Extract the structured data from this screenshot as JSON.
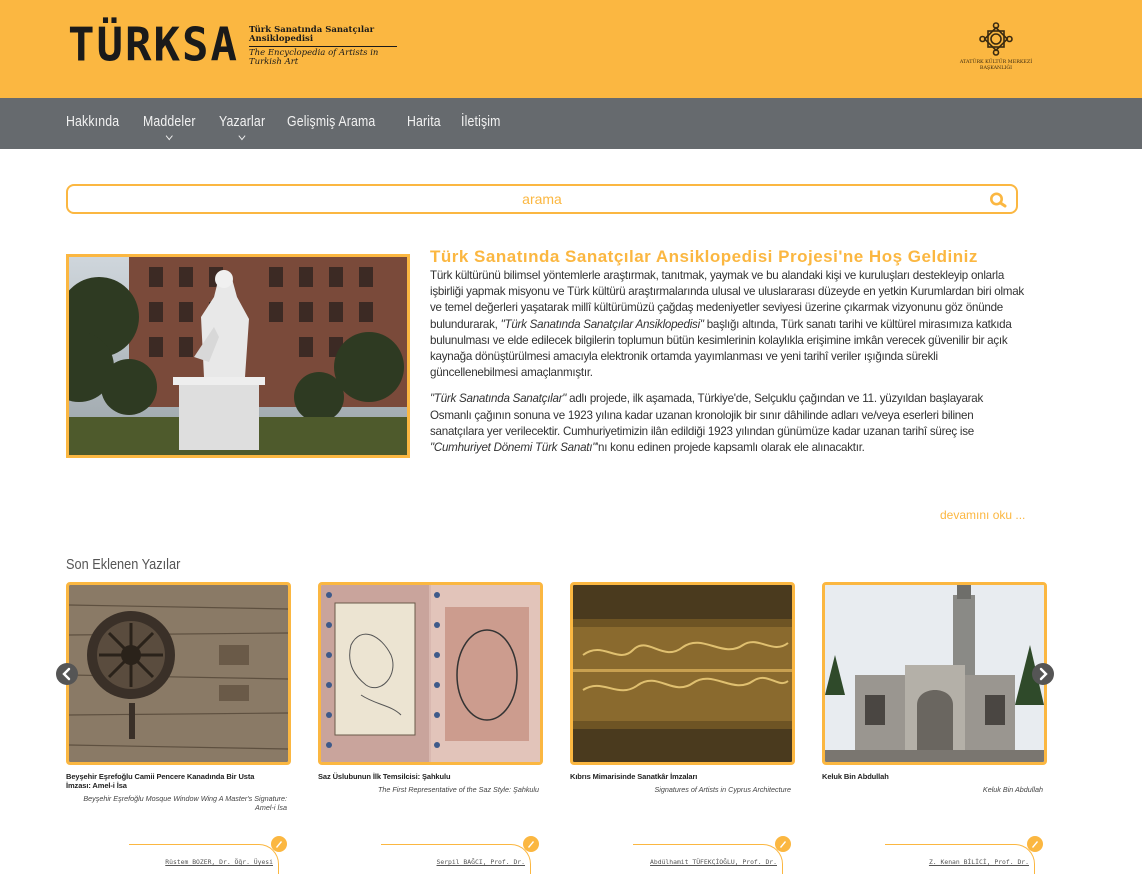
{
  "header": {
    "logo_word": "TÜRKSA",
    "logo_tr": "Türk Sanatında Sanatçılar Ansiklopedisi",
    "logo_en": "The Encyclopedia of Artists in Turkish Art",
    "org_line1": "ATATÜRK KÜLTÜR MERKEZİ",
    "org_line2": "BAŞKANLIĞI"
  },
  "nav": {
    "items": [
      {
        "label": "Hakkında"
      },
      {
        "label": "Maddeler"
      },
      {
        "label": "Yazarlar"
      },
      {
        "label": "Gelişmiş Arama"
      },
      {
        "label": "Harita"
      },
      {
        "label": "İletişim"
      }
    ]
  },
  "search": {
    "placeholder": "arama"
  },
  "welcome": {
    "title": "Türk Sanatında Sanatçılar Ansiklopedisi Projesi'ne Hoş Geldiniz",
    "p1_a": "Türk kültürünü bilimsel yöntemlerle araştırmak, tanıtmak, yaymak ve bu alandaki kişi ve kuruluşları destekleyip onlarla işbirliği yapmak misyonu ve Türk kültürü araştırmalarında ulusal ve uluslararası düzeyde en yetkin Kurumlardan biri olmak ve temel değerleri yaşatarak millî kültürümüzü çağdaş medeniyetler seviyesi üzerine çıkarmak vizyonunu göz önünde bulundurarak, ",
    "p1_em": "\"Türk Sanatında Sanatçılar Ansiklopedisi\"",
    "p1_b": " başlığı altında, Türk sanatı tarihi ve kültürel mirasımıza katkıda bulunulması ve elde edilecek bilgilerin toplumun bütün kesimlerinin kolaylıkla erişimine imkân verecek güvenilir bir açık kaynağa dönüştürülmesi amacıyla elektronik ortamda yayımlanması ve yeni tarihî veriler ışığında sürekli güncellenebilmesi amaçlanmıştır.",
    "p2_em": "\"Türk Sanatında Sanatçılar\"",
    "p2_a": " adlı projede, ilk aşamada, Türkiye'de, Selçuklu çağından ve 11. yüzyıldan başlayarak Osmanlı çağının sonuna ve 1923 yılına kadar uzanan kronolojik bir sınır dâhilinde adları ve/veya eserleri bilinen sanatçılara yer verilecektir. Cumhuriyetimizin ilân edildiği 1923 yılından günümüze kadar uzanan tarihî süreç ise ",
    "p2_em2": "\"Cumhuriyet Dönemi Türk Sanatı\"",
    "p2_b": "'nı konu edinen projede kapsamlı olarak ele alınacaktır.",
    "more": "devamını oku ..."
  },
  "recent": {
    "title": "Son Eklenen Yazılar",
    "cards": [
      {
        "tr_title": "Beyşehir Eşrefoğlu Camii Pencere Kanadında Bir Usta İmzası: Amel-i İsa",
        "en_title": "Beyşehir Eşrefoğlu Mosque Window Wing A Master's Signature: Amel-i İsa",
        "author": "Rüstem BOZER, Dr. Öğr. Üyesi"
      },
      {
        "tr_title": "Saz Üslubunun İlk Temsilcisi: Şahkulu",
        "en_title": "The First Representative of the Saz Style: Şahkulu",
        "author": "Serpil BAĞCI, Prof. Dr."
      },
      {
        "tr_title": "Kıbrıs Mimarisinde Sanatkâr İmzaları",
        "en_title": "Signatures of Artists in Cyprus Architecture",
        "author": "Abdülhamit TÜFEKÇİOĞLU, Prof. Dr."
      },
      {
        "tr_title": "Keluk Bin Abdullah",
        "en_title": "Keluk Bin Abdullah",
        "author": "Z. Kenan BİLİCİ, Prof. Dr."
      }
    ]
  },
  "colors": {
    "accent": "#fbb741",
    "nav": "#666a6e"
  },
  "icons": {
    "search": "search-icon",
    "prev": "chevron-left-icon",
    "next": "chevron-right-icon",
    "pen": "pen-icon"
  }
}
